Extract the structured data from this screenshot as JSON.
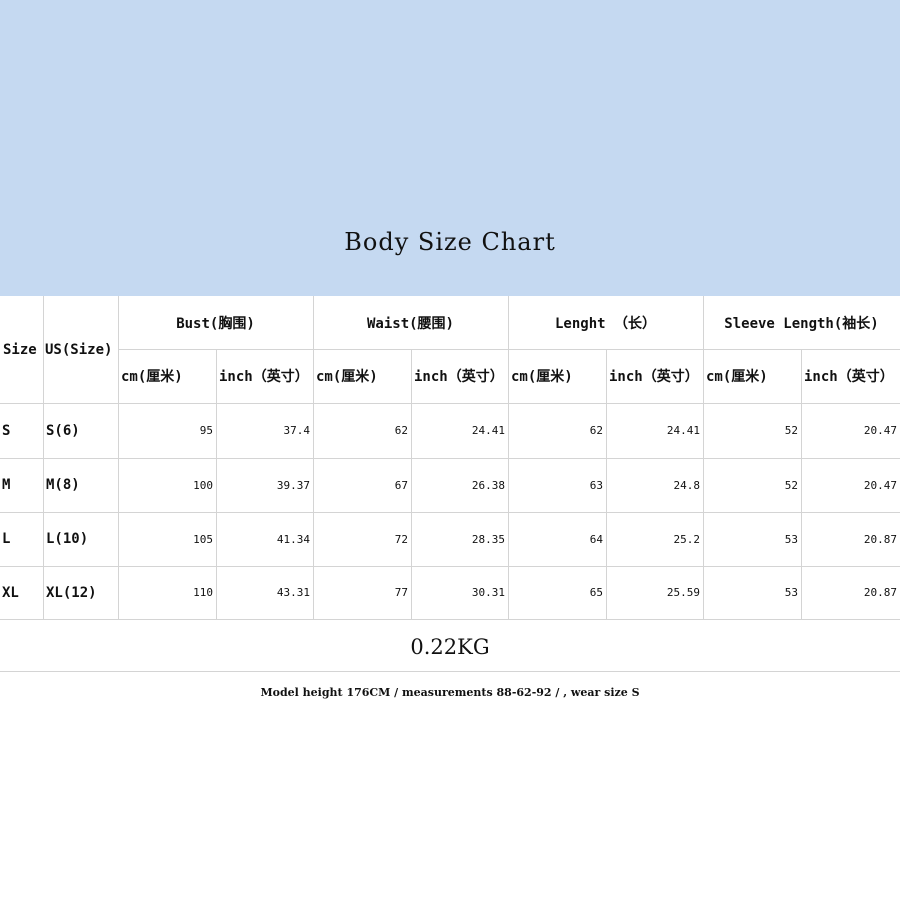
{
  "title": "Body Size Chart",
  "table": {
    "size_header": "Size",
    "us_header": "US(Size)",
    "groups": [
      "Bust(胸围)",
      "Waist(腰围)",
      "Lenght （长）",
      "Sleeve Length(袖长)"
    ],
    "units": [
      "cm(厘米)",
      "inch（英寸）"
    ],
    "rows": [
      {
        "size": "S",
        "us": "S(6)",
        "values": [
          "95",
          "37.4",
          "62",
          "24.41",
          "62",
          "24.41",
          "52",
          "20.47"
        ]
      },
      {
        "size": "M",
        "us": "M(8)",
        "values": [
          "100",
          "39.37",
          "67",
          "26.38",
          "63",
          "24.8",
          "52",
          "20.47"
        ]
      },
      {
        "size": "L",
        "us": "L(10)",
        "values": [
          "105",
          "41.34",
          "72",
          "28.35",
          "64",
          "25.2",
          "53",
          "20.87"
        ]
      },
      {
        "size": "XL",
        "us": "XL(12)",
        "values": [
          "110",
          "43.31",
          "77",
          "30.31",
          "65",
          "25.59",
          "53",
          "20.87"
        ]
      }
    ]
  },
  "weight": "0.22KG",
  "note": "Model height 176CM / measurements 88-62-92 / , wear size S",
  "colors": {
    "banner": "#c5d9f1",
    "grid_line": "#d4d4d4",
    "text": "#111111"
  }
}
